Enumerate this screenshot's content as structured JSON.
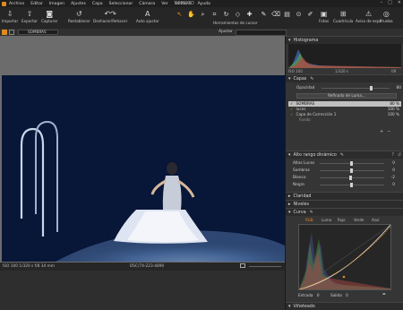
{
  "menubar": {
    "items": [
      "Archivo",
      "Editar",
      "Imagen",
      "Ajustes",
      "Capa",
      "Seleccionar",
      "Cámara",
      "Ver",
      "Ventana",
      "Ayuda"
    ],
    "doc_title": "REMOTO"
  },
  "toolbar": {
    "left_buttons": [
      {
        "label": "Importar",
        "icon": "import-icon"
      },
      {
        "label": "Exportar",
        "icon": "export-icon"
      },
      {
        "label": "Capturar",
        "icon": "camera-icon"
      },
      {
        "label": "Restablecer",
        "icon": "reset-icon"
      },
      {
        "label": "Deshacer/Rehacer",
        "icon": "undo-redo-icon"
      },
      {
        "label": "Auto ajustar",
        "icon": "auto-adjust-icon"
      }
    ],
    "center_label": "Herramientas de cursor",
    "right_buttons": [
      {
        "label": "Fotos",
        "icon": "photos-icon"
      },
      {
        "label": "Cuadrícula",
        "icon": "grid-icon"
      },
      {
        "label": "Aviso de expo",
        "icon": "exposure-warning-icon"
      },
      {
        "label": "Prueba",
        "icon": "proof-icon"
      }
    ]
  },
  "subbar": {
    "layer_select": "SOMBRAS",
    "adjust_label": "Ajustar"
  },
  "statusbar": {
    "left": "ISO 100   1/320 s   f/8   34 mm",
    "center": "DSC/74-223-4890"
  },
  "panel": {
    "histogram": {
      "title": "Histograma",
      "readout_left": "ISO 100",
      "readout_center": "1/320 s",
      "readout_right": "f/8"
    },
    "layers": {
      "title": "Capas",
      "opacity_label": "Opacidad",
      "opacity_value": "80",
      "mask_button": "Refinado de Luma...",
      "items": [
        {
          "name": "SOMBRAS",
          "value": "80 %",
          "selected": true
        },
        {
          "name": "luces",
          "value": "100 %",
          "selected": false
        },
        {
          "name": "Capa de Corrección 1",
          "value": "100 %",
          "selected": false
        },
        {
          "name": "Fondo",
          "value": "",
          "selected": false
        }
      ]
    },
    "hdr": {
      "title": "Alto rango dinámico",
      "sliders": [
        {
          "label": "Altas Luces",
          "value": "0",
          "pos": 0.5
        },
        {
          "label": "Sombras",
          "value": "0",
          "pos": 0.5
        },
        {
          "label": "Blanco",
          "value": "-2",
          "pos": 0.48
        },
        {
          "label": "Negro",
          "value": "0",
          "pos": 0.5
        }
      ]
    },
    "collapsed": [
      "Claridad",
      "Niveles"
    ],
    "curves": {
      "title": "Curva",
      "tabs": [
        "RGB",
        "Luma",
        "Rojo",
        "Verde",
        "Azul"
      ],
      "active_tab": "RGB",
      "input_label": "Entrada",
      "input_value": "0",
      "output_label": "Salida",
      "output_value": "0"
    },
    "vignette": {
      "title": "Viñeteado"
    }
  },
  "colors": {
    "accent": "#e08a1f",
    "selected_layer": "#b8b8b8",
    "photo_sky": "#071432"
  }
}
